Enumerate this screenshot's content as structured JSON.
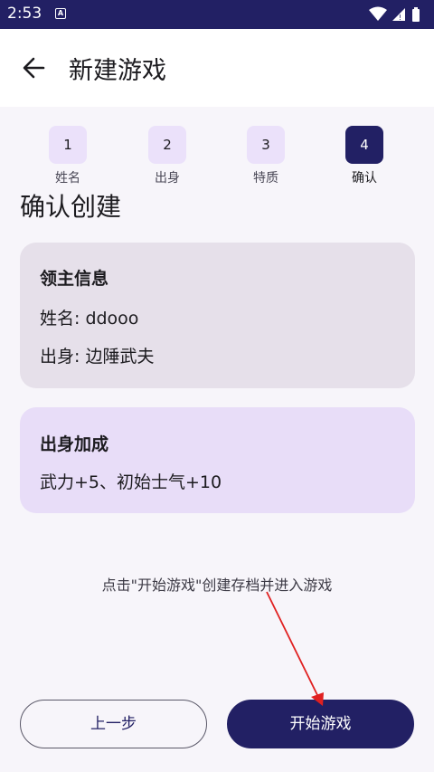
{
  "status_bar": {
    "time": "2:53",
    "sys_icon": "A"
  },
  "app_bar": {
    "title": "新建游戏",
    "back_icon": "arrow-left"
  },
  "steps": [
    {
      "number": "1",
      "label": "姓名",
      "active": false
    },
    {
      "number": "2",
      "label": "出身",
      "active": false
    },
    {
      "number": "3",
      "label": "特质",
      "active": false
    },
    {
      "number": "4",
      "label": "确认",
      "active": true
    }
  ],
  "section_title": "确认创建",
  "lord_card": {
    "title": "领主信息",
    "name_line": "姓名: ddooo",
    "origin_line": "出身: 边陲武夫"
  },
  "bonus_card": {
    "title": "出身加成",
    "text": "武力+5、初始士气+10"
  },
  "hint": "点击\"开始游戏\"创建存档并进入游戏",
  "buttons": {
    "prev": "上一步",
    "start": "开始游戏"
  },
  "colors": {
    "primary": "#222064",
    "card_gray": "#e6e0ea",
    "card_purple": "#e8ddf8",
    "step_inactive": "#ebe1fa",
    "annotation": "#e02020"
  }
}
